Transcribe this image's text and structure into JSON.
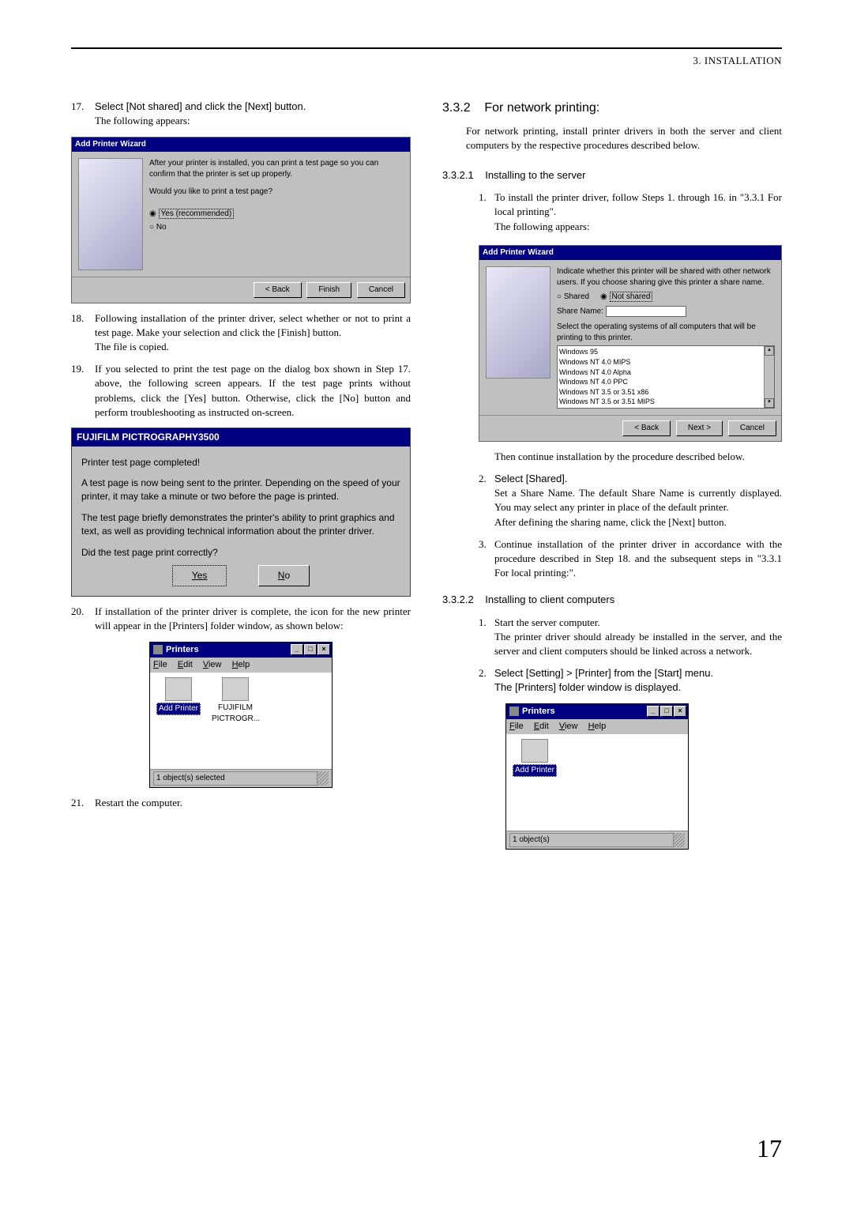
{
  "header": {
    "title": "3. INSTALLATION"
  },
  "page_number": "17",
  "left": {
    "step17": {
      "num": "17.",
      "text": "Select [Not shared] and click the [Next] button.",
      "followup": "The following appears:"
    },
    "wizard1": {
      "title": "Add Printer Wizard",
      "line1": "After your printer is installed, you can print a test page so you can confirm that the printer is set up properly.",
      "line2": "Would you like to print a test page?",
      "radio_yes": "Yes (recommended)",
      "radio_no": "No",
      "back": "< Back",
      "finish": "Finish",
      "cancel": "Cancel"
    },
    "step18": {
      "num": "18.",
      "text": "Following installation of the printer driver, select whether or not to print a test page. Make your selection and click the [Finish] button.",
      "followup": "The file is copied."
    },
    "step19": {
      "num": "19.",
      "text": "If you selected to print the test page on the dialog box shown in Step 17. above, the following screen appears. If the test page prints without problems, click the [Yes] button. Otherwise, click the [No] button and perform troubleshooting as instructed on-screen."
    },
    "testpage": {
      "title": "FUJIFILM PICTROGRAPHY3500",
      "line1": "Printer test page completed!",
      "line2": "A test page is now being sent to the printer. Depending on the speed of your printer, it may take a minute or two before the page is printed.",
      "line3": "The test page briefly demonstrates the printer's ability to print graphics and text, as well as providing technical information about the printer driver.",
      "line4": "Did the test page print correctly?",
      "yes": "Yes",
      "no": "No"
    },
    "step20": {
      "num": "20.",
      "text": "If installation of the printer driver is complete, the icon for the new printer will appear in the [Printers] folder window, as shown below:"
    },
    "printers1": {
      "title": "Printers",
      "menu_file": "File",
      "menu_edit": "Edit",
      "menu_view": "View",
      "menu_help": "Help",
      "icon1": "Add Printer",
      "icon2a": "FUJIFILM",
      "icon2b": "PICTROGR...",
      "status": "1 object(s) selected"
    },
    "step21": {
      "num": "21.",
      "text": "Restart the computer."
    }
  },
  "right": {
    "h2_num": "3.3.2",
    "h2_text": "For network printing:",
    "intro": "For network printing, install printer drivers in both the server and client computers by the respective procedures described below.",
    "h3a_num": "3.3.2.1",
    "h3a_text": "Installing to the server",
    "s1": {
      "num": "1.",
      "text": "To install the printer driver, follow Steps 1. through 16. in \"3.3.1 For local printing\".",
      "followup": "The following appears:"
    },
    "wizard2": {
      "title": "Add Printer Wizard",
      "line1": "Indicate whether this printer will be shared with other network users. If you choose sharing give this printer a share name.",
      "shared": "Shared",
      "not_shared": "Not shared",
      "share_name": "Share Name:",
      "line2": "Select the operating systems of all computers that will be printing to this printer.",
      "os1": "Windows 95",
      "os2": "Windows NT 4.0 MIPS",
      "os3": "Windows NT 4.0 Alpha",
      "os4": "Windows NT 4.0 PPC",
      "os5": "Windows NT 3.5 or 3.51 x86",
      "os6": "Windows NT 3.5 or 3.51 MIPS",
      "back": "< Back",
      "next": "Next >",
      "cancel": "Cancel"
    },
    "continue": "Then continue installation by the procedure described below.",
    "s2": {
      "num": "2.",
      "l1": "Select [Shared].",
      "l2": "Set a Share Name. The default Share Name is currently displayed. You may select any printer in place of the default printer.",
      "l3": "After defining the sharing name, click the [Next] button."
    },
    "s3": {
      "num": "3.",
      "text": "Continue installation of the printer driver in accordance with the procedure described in Step 18. and the subsequent steps in \"3.3.1 For local printing:\"."
    },
    "h3b_num": "3.3.2.2",
    "h3b_text": "Installing to client computers",
    "c1": {
      "num": "1.",
      "l1": "Start the server computer.",
      "l2": "The printer driver should already be installed in the server, and the server and client computers should be linked across a network."
    },
    "c2": {
      "num": "2.",
      "l1": "Select [Setting] > [Printer] from the [Start] menu.",
      "l2": "The [Printers] folder window is displayed."
    },
    "printers2": {
      "title": "Printers",
      "menu_file": "File",
      "menu_edit": "Edit",
      "menu_view": "View",
      "menu_help": "Help",
      "icon1": "Add Printer",
      "status": "1 object(s)"
    }
  }
}
